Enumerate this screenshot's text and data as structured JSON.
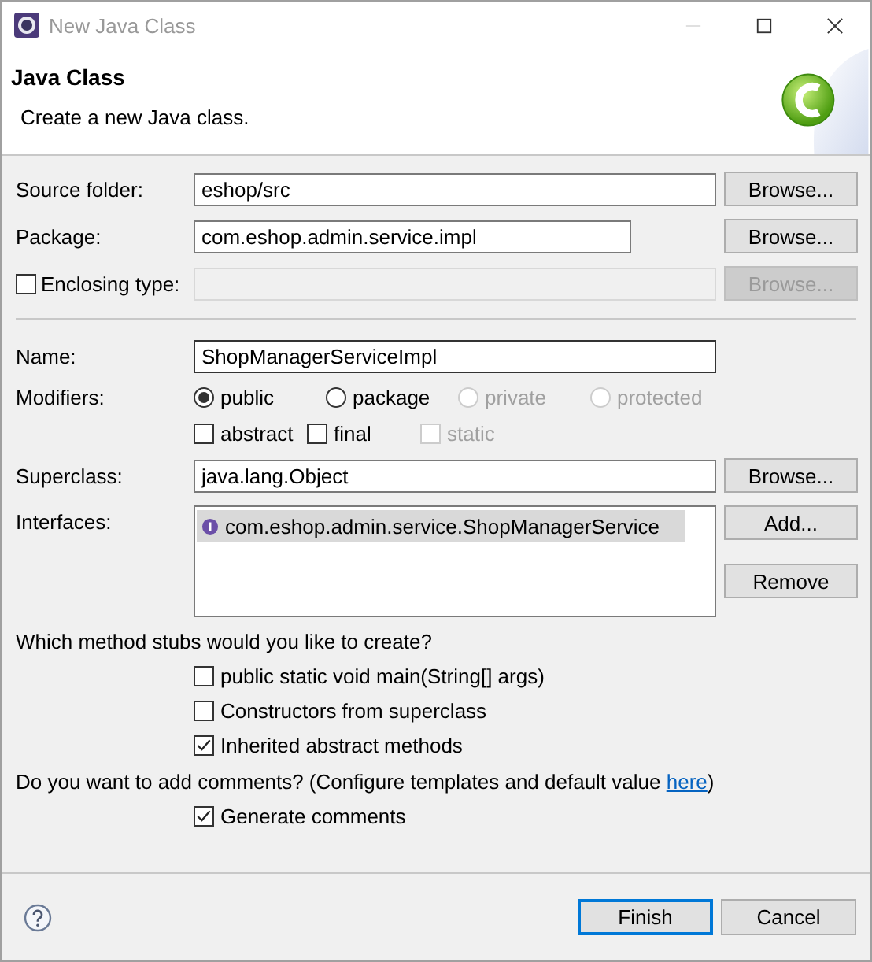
{
  "window": {
    "title": "New Java Class"
  },
  "header": {
    "title": "Java Class",
    "description": "Create a new Java class."
  },
  "source_folder": {
    "label": "Source folder:",
    "value": "eshop/src",
    "button": {
      "label": "Browse...",
      "disabled": false
    }
  },
  "package": {
    "label": "Package:",
    "value": "com.eshop.admin.service.impl",
    "button": {
      "label": "Browse...",
      "disabled": false
    }
  },
  "enclosing_type": {
    "label": "Enclosing type:",
    "checked": false,
    "field_disabled": true,
    "button": {
      "label": "Browse...",
      "disabled": true
    }
  },
  "name": {
    "label": "Name:",
    "value": "ShopManagerServiceImpl"
  },
  "modifiers": {
    "label": "Modifiers:",
    "access": [
      {
        "label": "public",
        "selected": true,
        "disabled": false
      },
      {
        "label": "package",
        "selected": false,
        "disabled": false
      },
      {
        "label": "private",
        "selected": false,
        "disabled": true
      },
      {
        "label": "protected",
        "selected": false,
        "disabled": true
      }
    ],
    "flags": [
      {
        "label": "abstract",
        "checked": false,
        "disabled": false
      },
      {
        "label": "final",
        "checked": false,
        "disabled": false
      },
      {
        "label": "static",
        "checked": false,
        "disabled": true
      }
    ]
  },
  "superclass": {
    "label": "Superclass:",
    "value": "java.lang.Object",
    "button": {
      "label": "Browse...",
      "disabled": false
    }
  },
  "interfaces": {
    "label": "Interfaces:",
    "items": [
      {
        "label": "com.eshop.admin.service.ShopManagerService",
        "selected": true
      }
    ],
    "buttons": [
      {
        "label": "Add...",
        "disabled": false
      },
      {
        "label": "Remove",
        "disabled": false
      }
    ]
  },
  "stubs": {
    "question": "Which method stubs would you like to create?",
    "options": [
      {
        "label": "public static void main(String[] args)",
        "checked": false
      },
      {
        "label": "Constructors from superclass",
        "checked": false
      },
      {
        "label": "Inherited abstract methods",
        "checked": true
      }
    ]
  },
  "comments": {
    "question_before": "Do you want to add comments? (Configure templates and default value",
    "link": "here",
    "question_after": ")",
    "options": [
      {
        "label": "Generate comments",
        "checked": true
      }
    ]
  },
  "footer": {
    "buttons": [
      {
        "label": "Finish",
        "default": true
      },
      {
        "label": "Cancel",
        "default": false
      }
    ]
  }
}
